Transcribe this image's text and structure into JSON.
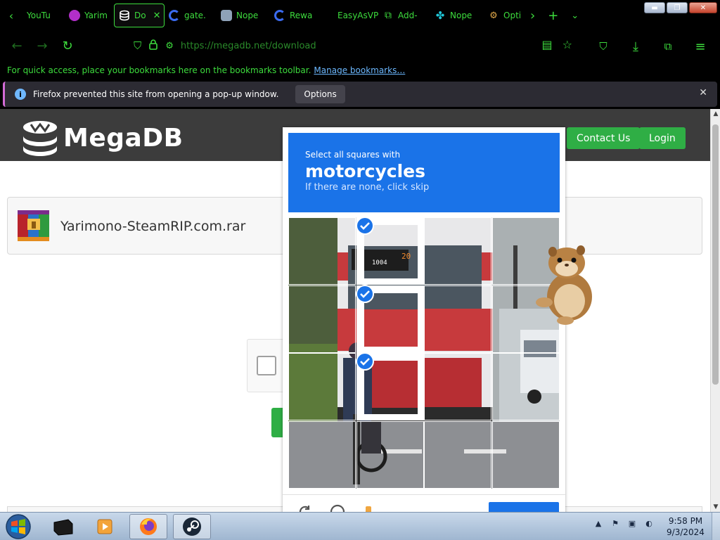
{
  "browser": {
    "tabs": [
      {
        "label": "YouTu",
        "favicon": "youtube-icon",
        "active": false
      },
      {
        "label": "Yarim",
        "favicon": "purple-site-icon",
        "active": false
      },
      {
        "label": "Do",
        "favicon": "database-icon",
        "active": true
      },
      {
        "label": "gate.",
        "favicon": "loading-ring-icon",
        "active": false
      },
      {
        "label": "Nope",
        "favicon": "robot-icon",
        "active": false
      },
      {
        "label": "Rewa",
        "favicon": "loading-ring-icon",
        "active": false
      },
      {
        "label": "EasyAsVP",
        "favicon": "",
        "active": false
      },
      {
        "label": "Add-",
        "favicon": "puzzle-icon",
        "active": false
      },
      {
        "label": "Nope",
        "favicon": "puzzle-blue-icon",
        "active": false
      },
      {
        "label": "Opti",
        "favicon": "person-gear-icon",
        "active": false
      }
    ],
    "close_glyph": "✕",
    "url": "https://megadb.net/download",
    "bookmarks_hint": "For quick access, place your bookmarks here on the bookmarks toolbar.",
    "bookmarks_link": "Manage bookmarks…",
    "popup_notice": "Firefox prevented this site from opening a pop-up window.",
    "popup_options": "Options"
  },
  "site": {
    "logo_text": "MegaDB",
    "contact_label": "Contact Us",
    "login_label": "Login",
    "file_name": "Yarimono-SteamRIP.com.rar",
    "colors": {
      "header": "#3c3c3c",
      "button": "#2fae45"
    }
  },
  "captcha": {
    "instruction_1": "Select all squares with",
    "target": "motorcycles",
    "instruction_2": "If there are none, click skip",
    "selected": [
      {
        "row": 0,
        "col": 1
      },
      {
        "row": 1,
        "col": 1
      },
      {
        "row": 2,
        "col": 1
      }
    ],
    "bus_number": "1004",
    "route_number": "20",
    "accent": "#1a73e8"
  },
  "taskbar": {
    "time": "9:58 PM",
    "date": "9/3/2024",
    "tray_arrow": "▲"
  }
}
